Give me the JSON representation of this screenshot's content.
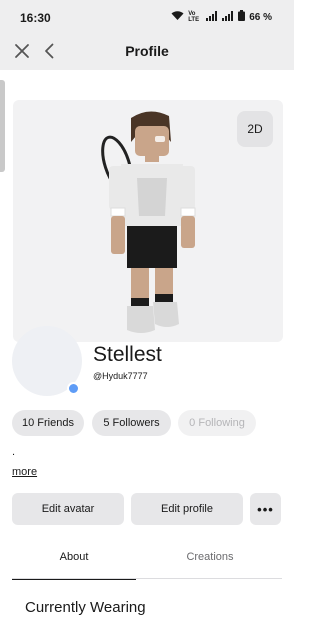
{
  "status_bar": {
    "time": "16:30",
    "network_label": "Vo LTE",
    "battery": "66 %"
  },
  "nav": {
    "title": "Profile",
    "close_icon": "close-icon",
    "back_icon": "chevron-left-icon"
  },
  "avatar": {
    "view_toggle_label": "2D"
  },
  "profile": {
    "display_name": "Stellest",
    "username": "@Hyduk7777",
    "online_indicator_color": "#5e9cf6"
  },
  "stats": {
    "friends": "10 Friends",
    "followers": "5 Followers",
    "following": "0 Following"
  },
  "bio": {
    "text": ".",
    "more_link": "more"
  },
  "actions": {
    "edit_avatar": "Edit avatar",
    "edit_profile": "Edit profile",
    "more_label": "•••"
  },
  "tabs": [
    {
      "label": "About",
      "active": true
    },
    {
      "label": "Creations",
      "active": false
    }
  ],
  "sections": {
    "currently_wearing": "Currently Wearing"
  }
}
